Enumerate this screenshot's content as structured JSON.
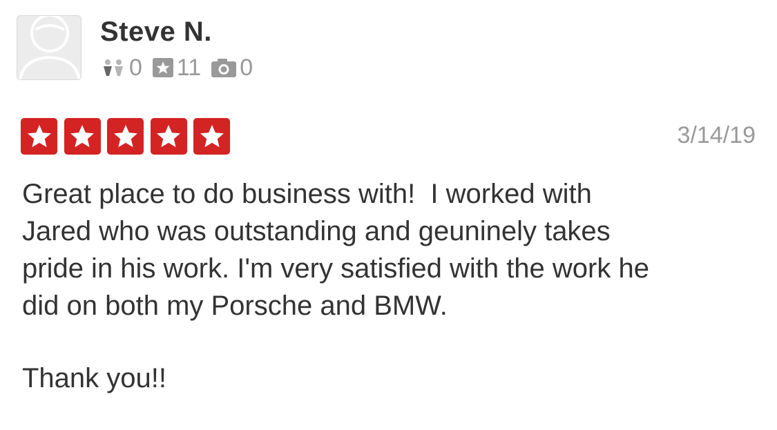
{
  "user": {
    "name": "Steve N.",
    "avatar_icon": "default-user-avatar-icon",
    "stats": {
      "friends": "0",
      "reviews": "11",
      "photos": "0"
    }
  },
  "review": {
    "rating": 5,
    "rating_max": 5,
    "date": "3/14/19",
    "lines": [
      "Great place to do business with!  I worked with",
      "Jared who was outstanding and geuninely takes",
      "pride in his work. I'm very satisfied with the work he",
      "did on both my Porsche and BMW."
    ],
    "closing": "Thank you!!"
  },
  "colors": {
    "star_red": "#d32323",
    "muted_gray": "#999999",
    "text_dark": "#333333"
  },
  "icons": {
    "friends": "friends-icon",
    "reviews": "star-badge-icon",
    "photos": "camera-icon"
  }
}
